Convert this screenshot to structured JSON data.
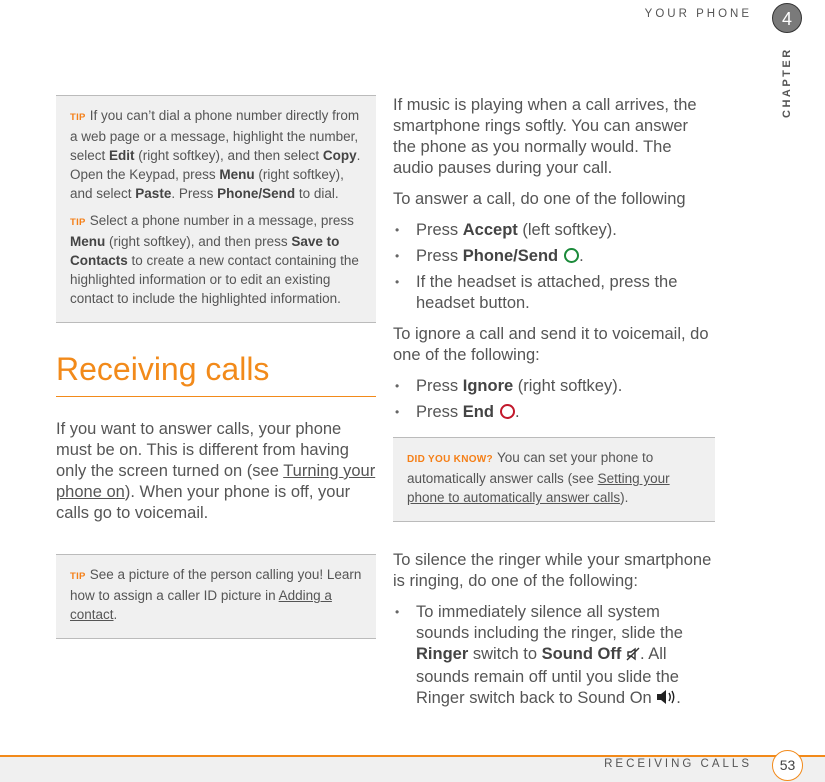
{
  "header": {
    "section_title": "YOUR PHONE",
    "chapter_number": "4",
    "chapter_label": "CHAPTER"
  },
  "left": {
    "tips": [
      {
        "label": "TIP",
        "parts": [
          "If you can’t dial a phone number directly from a web page or a message, highlight the number, select ",
          "Edit",
          " (right softkey), and then select ",
          "Copy",
          ". Open the Keypad, press ",
          "Menu",
          " (right softkey), and select ",
          "Paste",
          ". Press ",
          "Phone/Send",
          " to dial."
        ]
      },
      {
        "label": "TIP",
        "parts": [
          "Select a phone number in a message, press ",
          "Menu",
          " (right softkey), and then press ",
          "Save to Contacts",
          " to create a new contact containing the highlighted information or to edit an existing contact to include the highlighted information."
        ]
      }
    ],
    "section_heading": "Receiving calls",
    "intro": {
      "before": "If you want to answer calls, your phone must be on. This is different from having only the screen turned on (see ",
      "link": "Turning your phone on",
      "after": "). When your phone is off, your calls go to voicemail."
    },
    "tip3": {
      "label": "TIP",
      "before": "See a picture of the person calling you! Learn how to assign a caller ID picture in ",
      "link": "Adding a contact",
      "after": "."
    }
  },
  "right": {
    "music_para": "If music is playing when a call arrives, the smartphone rings softly. You can answer the phone as you normally would. The audio pauses during your call.",
    "answer_intro": "To answer a call, do one of the following",
    "answer_items": [
      {
        "pre": "Press ",
        "bold": "Accept",
        "post": " (left softkey)."
      },
      {
        "pre": "Press ",
        "bold": "Phone/Send",
        "post": "."
      },
      {
        "pre": "If the headset is attached, press the headset button.",
        "bold": "",
        "post": ""
      }
    ],
    "ignore_intro": "To ignore a call and send it to voicemail, do one of the following:",
    "ignore_items": [
      {
        "pre": "Press ",
        "bold": "Ignore",
        "post": " (right softkey)."
      },
      {
        "pre": "Press ",
        "bold": "End",
        "post": "."
      }
    ],
    "did_you_know": {
      "label": "DID YOU KNOW?",
      "before": "You can set your phone to automatically answer calls (see ",
      "link": "Setting your phone to automatically answer calls",
      "after": ")."
    },
    "silence_intro": "To silence the ringer while your smartphone is ringing, do one of the following:",
    "silence_item": {
      "p1": "To immediately silence all system sounds including the ringer, slide the ",
      "b1": "Ringer",
      "p2": " switch to ",
      "b2": "Sound Off",
      "p3": ". All sounds remain off until you slide the Ringer switch back to Sound On ",
      "p4": "."
    }
  },
  "footer": {
    "section_title": "RECEIVING CALLS",
    "page_number": "53"
  },
  "colors": {
    "accent_orange": "#f28a1a",
    "send_green": "#1b8a3a",
    "end_red": "#c2182b"
  }
}
